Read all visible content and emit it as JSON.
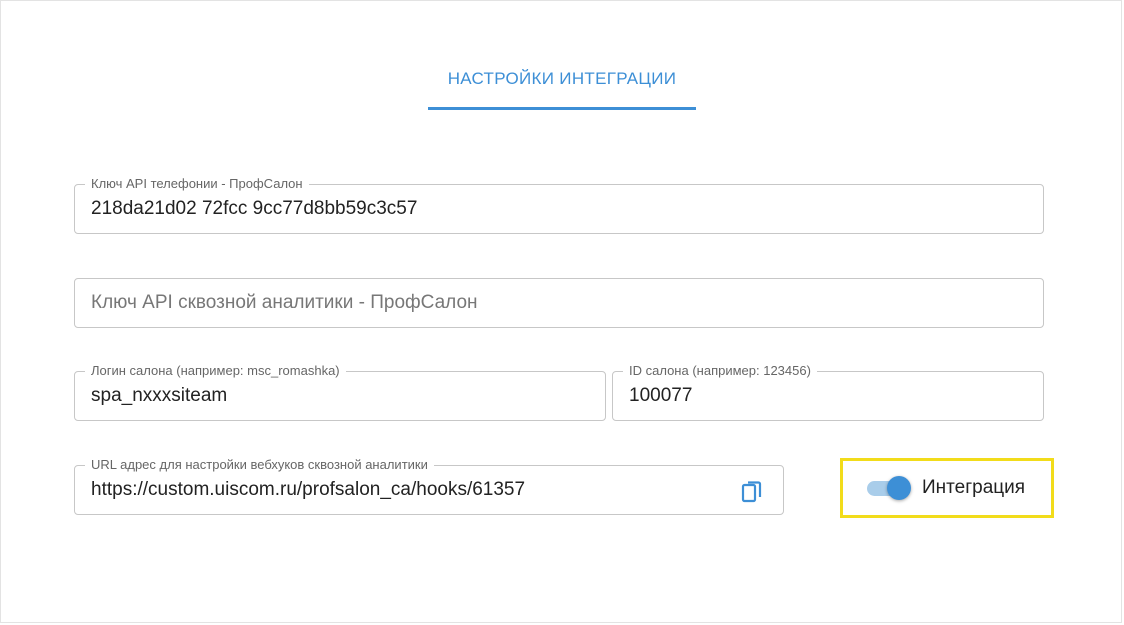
{
  "tab": {
    "label": "НАСТРОЙКИ ИНТЕГРАЦИИ"
  },
  "fields": {
    "telephony_key": {
      "label": "Ключ API телефонии - ПрофСалон",
      "value": "218da21d​02 72fcc 9cc77d8bb59c3c57"
    },
    "analytics_key": {
      "placeholder": "Ключ API сквозной аналитики - ПрофСалон",
      "value": ""
    },
    "salon_login": {
      "label": "Логин салона (например: msc_romashka)",
      "value": "spa_nxxxsiteam"
    },
    "salon_id": {
      "label": "ID салона (например: 123456)",
      "value": "100077"
    },
    "webhook_url": {
      "label": "URL адрес для настройки вебхуков сквозной аналитики",
      "value": "https://custom.uiscom.ru/profsalon_ca/hooks/61357"
    }
  },
  "integration_toggle": {
    "label": "Интеграция",
    "checked": true
  },
  "colors": {
    "accent": "#3d8fd6",
    "highlight": "#f2dc1a",
    "border": "#c7c7c7"
  },
  "icons": {
    "copy": "copy-icon"
  }
}
